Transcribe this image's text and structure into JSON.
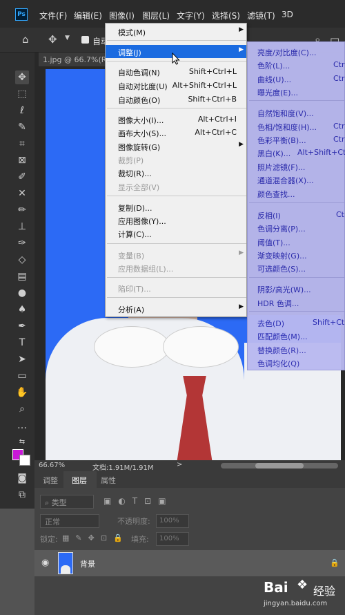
{
  "app": {
    "logo": "Ps"
  },
  "menubar": {
    "items": [
      "文件(F)",
      "编辑(E)",
      "图像(I)",
      "图层(L)",
      "文字(Y)",
      "选择(S)",
      "滤镜(T)",
      "3D"
    ]
  },
  "options": {
    "auto_label": "自动"
  },
  "document": {
    "tab": "1.jpg @ 66.7%(RG"
  },
  "status": {
    "zoom": "66.67%",
    "doc_size": "文档:1.91M/1.91M",
    "arrow": ">"
  },
  "panel": {
    "tabs": [
      "调整",
      "图层",
      "属性"
    ],
    "filter_placeholder": "类型",
    "blend_mode": "正常",
    "opacity_label": "不透明度:",
    "opacity_value": "100%",
    "lock_label": "锁定:",
    "fill_label": "填充:",
    "fill_value": "100%",
    "layer_name": "背景"
  },
  "image_menu": [
    {
      "label": "模式(M)",
      "arrow": "▶"
    },
    {
      "label": "调整(J)",
      "arrow": "▶"
    },
    {
      "label": "自动色调(N)",
      "shortcut": "Shift+Ctrl+L"
    },
    {
      "label": "自动对比度(U)",
      "shortcut": "Alt+Shift+Ctrl+L"
    },
    {
      "label": "自动颜色(O)",
      "shortcut": "Shift+Ctrl+B"
    },
    {
      "label": "图像大小(I)...",
      "shortcut": "Alt+Ctrl+I"
    },
    {
      "label": "画布大小(S)...",
      "shortcut": "Alt+Ctrl+C"
    },
    {
      "label": "图像旋转(G)",
      "arrow": "▶"
    },
    {
      "label": "裁剪(P)"
    },
    {
      "label": "裁切(R)..."
    },
    {
      "label": "显示全部(V)"
    },
    {
      "label": "复制(D)..."
    },
    {
      "label": "应用图像(Y)..."
    },
    {
      "label": "计算(C)..."
    },
    {
      "label": "变量(B)",
      "arrow": "▶"
    },
    {
      "label": "应用数据组(L)..."
    },
    {
      "label": "陷印(T)..."
    },
    {
      "label": "分析(A)",
      "arrow": "▶"
    }
  ],
  "adjust_menu": [
    {
      "label": "亮度/对比度(C)..."
    },
    {
      "label": "色阶(L)...",
      "shortcut": "Ctr"
    },
    {
      "label": "曲线(U)...",
      "shortcut": "Ctr"
    },
    {
      "label": "曝光度(E)..."
    },
    {
      "label": "自然饱和度(V)..."
    },
    {
      "label": "色相/饱和度(H)...",
      "shortcut": "Ctr"
    },
    {
      "label": "色彩平衡(B)...",
      "shortcut": "Ctr"
    },
    {
      "label": "黑白(K)...",
      "shortcut": "Alt+Shift+Ctr"
    },
    {
      "label": "照片滤镜(F)..."
    },
    {
      "label": "通道混合器(X)..."
    },
    {
      "label": "颜色查找..."
    },
    {
      "label": "反相(I)",
      "shortcut": "Ct"
    },
    {
      "label": "色调分离(P)..."
    },
    {
      "label": "阈值(T)..."
    },
    {
      "label": "渐变映射(G)..."
    },
    {
      "label": "可选颜色(S)..."
    },
    {
      "label": "阴影/高光(W)..."
    },
    {
      "label": "HDR 色调..."
    },
    {
      "label": "去色(D)",
      "shortcut": "Shift+Ctr"
    },
    {
      "label": "匹配颜色(M)..."
    },
    {
      "label": "替换颜色(R)..."
    },
    {
      "label": "色调均化(Q)"
    }
  ],
  "watermark": {
    "logo": "Bai",
    "paw": "❖",
    "cn": "经验",
    "url": "jingyan.baidu.com"
  },
  "colors": {
    "foreground": "#c818d8",
    "background": "#ffffff",
    "highlight": "#1b6be0"
  }
}
